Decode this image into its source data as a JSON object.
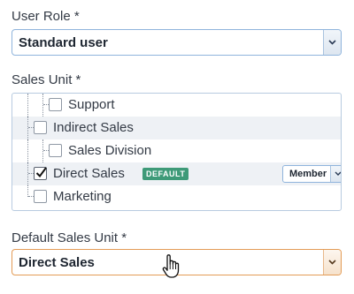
{
  "user_role": {
    "label": "User Role *",
    "selected": "Standard user"
  },
  "sales_unit": {
    "label": "Sales Unit *",
    "items": [
      {
        "label": "Support",
        "checked": false
      },
      {
        "label": "Indirect Sales",
        "checked": false
      },
      {
        "label": "Sales Division",
        "checked": false
      },
      {
        "label": "Direct Sales",
        "checked": true,
        "badge": "DEFAULT",
        "role": "Member"
      },
      {
        "label": "Marketing",
        "checked": false
      }
    ]
  },
  "default_sales_unit": {
    "label": "Default Sales Unit *",
    "selected": "Direct Sales"
  },
  "colors": {
    "accent_border": "#8fb4dc",
    "focus_border": "#e39b55",
    "badge_bg": "#3e9a78"
  }
}
